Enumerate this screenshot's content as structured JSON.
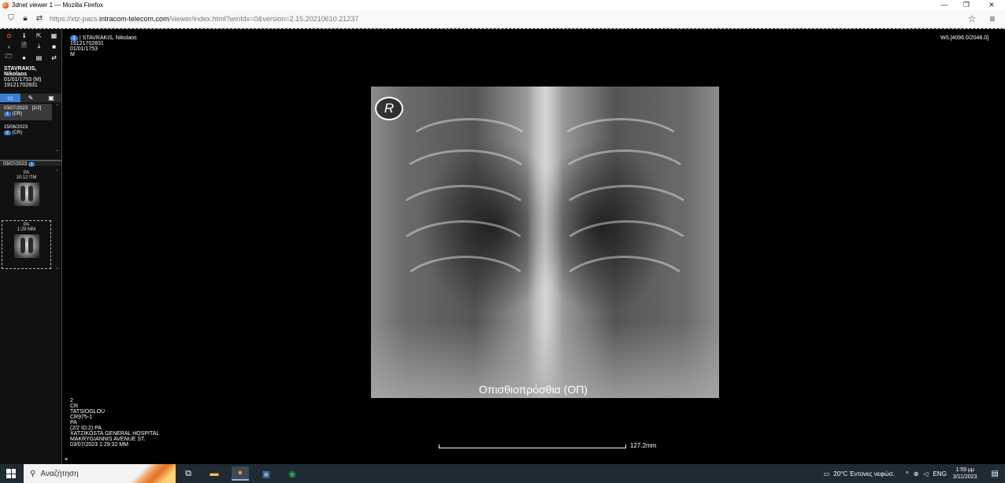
{
  "window": {
    "title": "3dnet viewer 1 — Mozilla Firefox",
    "minimize": "—",
    "maximize": "❐",
    "close": "✕"
  },
  "browser": {
    "url_prefix": "https://xtz-pacs.",
    "url_domain": "intracom-telecom.com",
    "url_path": "/viewer/index.html?winIdx=0&version=2.15.20210610.21237",
    "star": "☆",
    "menu": "≡"
  },
  "toolbar": {
    "row1": [
      "⊙",
      "ℹ",
      "⇱",
      "▦"
    ],
    "row2": [
      "‹",
      "🗎",
      "⤓",
      "■"
    ],
    "row3": [
      "🗁",
      "●",
      "▤",
      "⇄"
    ]
  },
  "patient": {
    "name_line1": "STAVRAKIS,",
    "name_line2": "Nikolaos",
    "dob_sex": "01/01/1753 (M)",
    "id": "19121702831"
  },
  "tabs": [
    "▭",
    "✎",
    "▣"
  ],
  "studies": [
    {
      "date": "03/07/2023",
      "count": "[2/2]",
      "badge": "1",
      "modality": "(CR)"
    },
    {
      "date": "15/06/2023",
      "count": "",
      "badge": "2",
      "modality": "(CR)"
    }
  ],
  "series_header": {
    "date": "03/07/2023",
    "badge": "1"
  },
  "thumbnails": [
    {
      "view": "PA",
      "time": "10:12 ΠΜ"
    },
    {
      "view": "PA",
      "time": "1:29 ΜΜ"
    }
  ],
  "left_bottom_icon": "≡",
  "overlay_top_left": {
    "badge": "1",
    "name": "| STAVRAKIS, Nikolaos",
    "id": "19121702831",
    "dob": "01/01/1753",
    "sex": "M"
  },
  "overlay_top_right": {
    "wl": "W/L[4096.0/2048.0]"
  },
  "overlay_bottom_left": {
    "series": "2",
    "modality": "CR",
    "physician": "TATSIOGLOU",
    "device": "CR975-1",
    "view": "PA",
    "image_info": "(2/2 ID:2) PA",
    "hospital": "XATZIKOSTA GENERAL HOSPITAL",
    "street": "MAKRYGIANNIS AVENUE ST.",
    "datetime": "03/07/2023 1:29:32 MM"
  },
  "image": {
    "marker": "R",
    "view_label": "Οπισθιοπρόσθια (ΟΠ)",
    "scale_text": "127.2mm"
  },
  "taskbar": {
    "search_placeholder": "Αναζήτηση",
    "weather": "20°C  Έντονες νεφώσ.",
    "language": "ENG",
    "time": "1:59 μμ",
    "date": "3/11/2023"
  }
}
